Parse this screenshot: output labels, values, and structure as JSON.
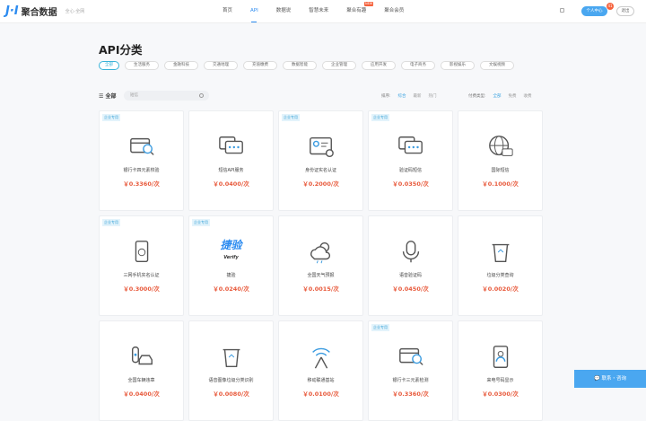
{
  "header": {
    "logo": "聚合数据",
    "tagline": "全心·全网",
    "nav": [
      {
        "label": "首页"
      },
      {
        "label": "API",
        "active": true
      },
      {
        "label": "数据说"
      },
      {
        "label": "智慧未来"
      },
      {
        "label": "聚合有趣",
        "badge": "NEW"
      },
      {
        "label": "聚合会员"
      }
    ],
    "user_center": "个人中心",
    "user_badge": "41",
    "logout": "退出"
  },
  "title": "API分类",
  "categories": [
    "全部",
    "生活服务",
    "金融科技",
    "交通地理",
    "充值缴费",
    "数据智能",
    "企业管理",
    "应用开发",
    "电子商务",
    "影视娱乐",
    "文娱视频"
  ],
  "filter": {
    "all_label": "全部",
    "search_placeholder": "短信",
    "sort_label": "排序:",
    "sort_options": [
      "综合",
      "最新",
      "热门"
    ],
    "pay_label": "付费类型:",
    "pay_options": [
      "全部",
      "免费",
      "收费"
    ]
  },
  "cards": [
    {
      "name": "银行卡四元素校验",
      "price": "￥0.3360/次",
      "enterprise": true,
      "icon": "bank-card-check-icon"
    },
    {
      "name": "短信API服务",
      "price": "￥0.0400/次",
      "enterprise": false,
      "icon": "chat-bubbles-icon"
    },
    {
      "name": "身份证实名认证",
      "price": "￥0.2000/次",
      "enterprise": true,
      "icon": "id-card-icon"
    },
    {
      "name": "验证码短信",
      "price": "￥0.0350/次",
      "enterprise": true,
      "icon": "chat-bubbles-icon"
    },
    {
      "name": "国际短信",
      "price": "￥0.1000/次",
      "enterprise": false,
      "icon": "globe-icon"
    },
    {
      "name": "三网手机实名认证",
      "price": "￥0.3000/次",
      "enterprise": true,
      "icon": "phone-icon"
    },
    {
      "name": "捷验",
      "price": "￥0.0240/次",
      "enterprise": true,
      "icon": "jieyan-logo-icon",
      "logo_text": "捷验",
      "logo_sub": "Verify"
    },
    {
      "name": "全国天气预报",
      "price": "￥0.0015/次",
      "enterprise": false,
      "icon": "weather-icon"
    },
    {
      "name": "语音验证码",
      "price": "￥0.0450/次",
      "enterprise": false,
      "icon": "microphone-icon"
    },
    {
      "name": "垃圾分类查询",
      "price": "￥0.0020/次",
      "enterprise": false,
      "icon": "trash-bin-icon"
    },
    {
      "name": "全国车辆违章",
      "price": "￥0.0400/次",
      "enterprise": false,
      "icon": "traffic-car-icon"
    },
    {
      "name": "语音图像垃圾分类识别",
      "price": "￥0.0080/次",
      "enterprise": false,
      "icon": "trash-bin-icon"
    },
    {
      "name": "移动联通基站",
      "price": "￥0.0100/次",
      "enterprise": false,
      "icon": "signal-tower-icon"
    },
    {
      "name": "银行卡三元素检测",
      "price": "￥0.3360/次",
      "enterprise": true,
      "icon": "bank-card-check-icon"
    },
    {
      "name": "来电号码显示",
      "price": "￥0.0300/次",
      "enterprise": false,
      "icon": "caller-id-icon"
    }
  ],
  "enterprise_label": "企业专用",
  "contact": "联系・咨询",
  "colors": {
    "accent": "#2d8cf0",
    "price": "#e85a3c"
  }
}
